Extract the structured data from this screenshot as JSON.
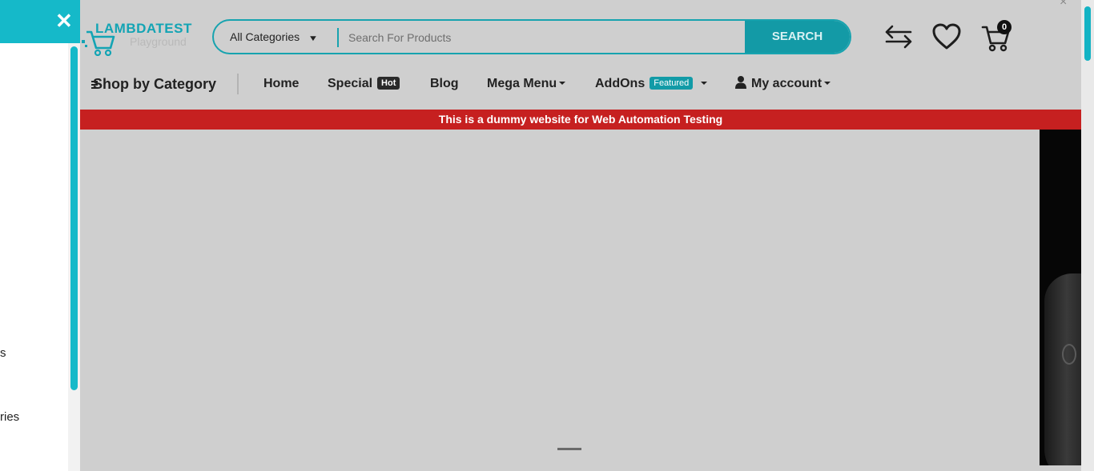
{
  "header": {
    "logo": {
      "brand": "LAMBDATEST",
      "sub": "Playground",
      "icon": "cart-logo-icon"
    },
    "search": {
      "category_label": "All Categories",
      "placeholder": "Search For Products",
      "button_label": "SEARCH"
    },
    "cart_count": "0",
    "close_symbol": "×"
  },
  "nav": {
    "shop_by_category": "Shop by Category",
    "items": [
      {
        "label": "Home"
      },
      {
        "label": "Special",
        "badge": "Hot"
      },
      {
        "label": "Blog"
      },
      {
        "label": "Mega Menu"
      },
      {
        "label": "AddOns",
        "badge": "Featured"
      },
      {
        "label": "My account"
      }
    ]
  },
  "banner": {
    "text": "This is a dummy website for Web Automation Testing"
  },
  "drawer": {
    "close_symbol": "✕",
    "fragments": [
      "s",
      "ries"
    ]
  },
  "colors": {
    "accent": "#15b9c9",
    "banner": "#c62020",
    "overlay": "#cfcfcf"
  }
}
